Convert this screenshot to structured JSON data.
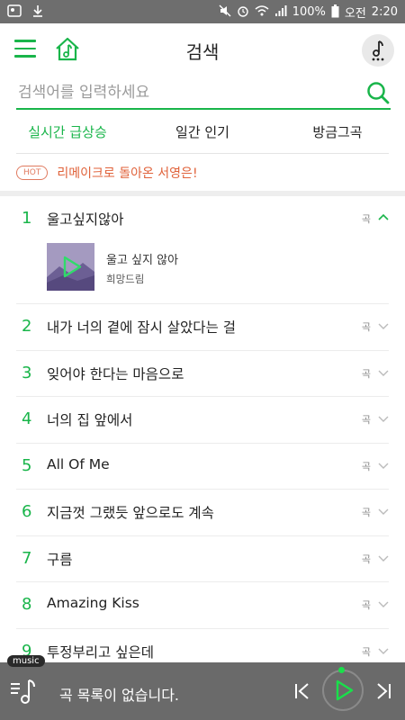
{
  "status_bar": {
    "battery": "100%",
    "ampm": "오전",
    "time": "2:20",
    "icons": [
      "gallery-icon",
      "download-icon",
      "mute-icon",
      "alarm-icon",
      "wifi-icon",
      "signal-icon",
      "battery-icon"
    ]
  },
  "header": {
    "title": "검색",
    "menu_icon": "hamburger-icon",
    "home_icon": "home-music-icon",
    "music_icon": "music-note-icon"
  },
  "search": {
    "placeholder": "검색어를 입력하세요",
    "value": ""
  },
  "tabs": [
    {
      "label": "실시간 급상승",
      "active": true
    },
    {
      "label": "일간 인기",
      "active": false
    },
    {
      "label": "방금그곡",
      "active": false
    }
  ],
  "hot": {
    "badge": "HOT",
    "text": "리메이크로 돌아온 서영은!"
  },
  "list": {
    "kind_label": "곡",
    "items": [
      {
        "rank": "1",
        "title": "울고싶지않아",
        "expanded": true,
        "song": "울고 싶지 않아",
        "artist": "희망드림"
      },
      {
        "rank": "2",
        "title": "내가 너의 곁에 잠시 살았다는 걸"
      },
      {
        "rank": "3",
        "title": "잊어야 한다는 마음으로"
      },
      {
        "rank": "4",
        "title": "너의 집 앞에서"
      },
      {
        "rank": "5",
        "title": "All Of Me"
      },
      {
        "rank": "6",
        "title": "지금껏 그랬듯 앞으로도 계속"
      },
      {
        "rank": "7",
        "title": "구름"
      },
      {
        "rank": "8",
        "title": "Amazing Kiss"
      },
      {
        "rank": "9",
        "title": "투정부리고 싶은데"
      }
    ]
  },
  "player": {
    "tag": "music",
    "message": "곡 목록이 없습니다.",
    "accent": "#19b54a"
  },
  "colors": {
    "accent": "#19b54a",
    "hot": "#e0623a",
    "statusbar": "#6e6e6e",
    "player": "#6a6a6a"
  }
}
